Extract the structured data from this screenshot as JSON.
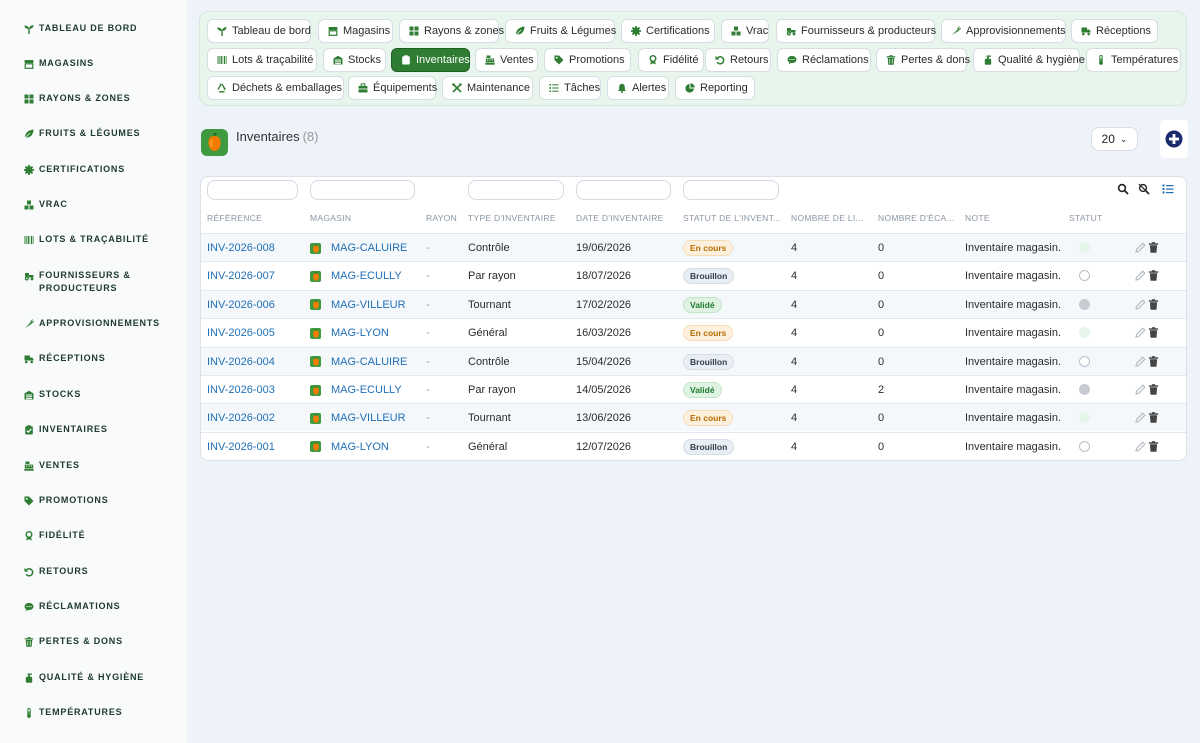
{
  "sidebar": {
    "items": [
      {
        "label": "Tableau de bord",
        "icon": "seedling-icon"
      },
      {
        "label": "Magasins",
        "icon": "store-icon"
      },
      {
        "label": "Rayons & zones",
        "icon": "grid-icon"
      },
      {
        "label": "Fruits & légumes",
        "icon": "leaf-icon"
      },
      {
        "label": "Certifications",
        "icon": "certificate-icon"
      },
      {
        "label": "Vrac",
        "icon": "boxes-icon"
      },
      {
        "label": "Lots & traçabilité",
        "icon": "barcode-icon"
      },
      {
        "label": "Fournisseurs & producteurs",
        "icon": "tractor-icon"
      },
      {
        "label": "Approvisionnements",
        "icon": "carrot-icon"
      },
      {
        "label": "Réceptions",
        "icon": "truck-icon"
      },
      {
        "label": "Stocks",
        "icon": "warehouse-icon"
      },
      {
        "label": "Inventaires",
        "icon": "clipboard-check-icon"
      },
      {
        "label": "Ventes",
        "icon": "cash-register-icon"
      },
      {
        "label": "Promotions",
        "icon": "tag-icon"
      },
      {
        "label": "Fidélité",
        "icon": "award-icon"
      },
      {
        "label": "Retours",
        "icon": "undo-icon"
      },
      {
        "label": "Réclamations",
        "icon": "comment-icon"
      },
      {
        "label": "Pertes & dons",
        "icon": "trash-icon"
      },
      {
        "label": "Qualité & hygiène",
        "icon": "pump-soap-icon"
      },
      {
        "label": "Températures",
        "icon": "thermometer-icon"
      }
    ]
  },
  "topnav": {
    "items": [
      {
        "label": "Tableau de bord",
        "icon": "seedling-icon"
      },
      {
        "label": "Magasins",
        "icon": "store-icon"
      },
      {
        "label": "Rayons & zones",
        "icon": "grid-icon"
      },
      {
        "label": "Fruits & Légumes",
        "icon": "leaf-icon"
      },
      {
        "label": "Certifications",
        "icon": "certificate-icon"
      },
      {
        "label": "Vrac",
        "icon": "boxes-icon"
      },
      {
        "label": "Fournisseurs & producteurs",
        "icon": "tractor-icon"
      },
      {
        "label": "Approvisionnements",
        "icon": "carrot-icon"
      },
      {
        "label": "Réceptions",
        "icon": "truck-icon"
      },
      {
        "label": "Lots & traçabilité",
        "icon": "barcode-icon"
      },
      {
        "label": "Stocks",
        "icon": "warehouse-icon"
      },
      {
        "label": "Inventaires",
        "icon": "clipboard-check-icon",
        "active": true
      },
      {
        "label": "Ventes",
        "icon": "cash-register-icon"
      },
      {
        "label": "Promotions",
        "icon": "tag-icon"
      },
      {
        "label": "Fidélité",
        "icon": "award-icon"
      },
      {
        "label": "Retours",
        "icon": "undo-icon"
      },
      {
        "label": "Réclamations",
        "icon": "comment-icon"
      },
      {
        "label": "Pertes & dons",
        "icon": "trash-icon"
      },
      {
        "label": "Qualité & hygiène",
        "icon": "pump-soap-icon"
      },
      {
        "label": "Températures",
        "icon": "thermometer-icon"
      },
      {
        "label": "Déchets & emballages",
        "icon": "recycle-icon"
      },
      {
        "label": "Équipements",
        "icon": "toolbox-icon"
      },
      {
        "label": "Maintenance",
        "icon": "tools-icon"
      },
      {
        "label": "Tâches",
        "icon": "tasks-icon"
      },
      {
        "label": "Alertes",
        "icon": "bell-icon"
      },
      {
        "label": "Reporting",
        "icon": "chart-pie-icon"
      }
    ]
  },
  "header": {
    "title": "Inventaires",
    "count": "(8)",
    "page_size": "20"
  },
  "table": {
    "columns": [
      "Référence",
      "Magasin",
      "Rayon",
      "Type d'inventaire",
      "Date d'inventaire",
      "Statut de l'invent...",
      "Nombre de li...",
      "Nombre d'éca...",
      "Note",
      "Statut"
    ],
    "rows": [
      {
        "ref": "INV-2026-008",
        "store": "MAG-CALUIRE",
        "rayon": "-",
        "type": "Contrôle",
        "date": "19/06/2026",
        "status": "En cours",
        "status_kind": "encours",
        "lines": "4",
        "gaps": "0",
        "note": "Inventaire magasin.",
        "state": "light"
      },
      {
        "ref": "INV-2026-007",
        "store": "MAG-ECULLY",
        "rayon": "-",
        "type": "Par rayon",
        "date": "18/07/2026",
        "status": "Brouillon",
        "status_kind": "brouillon",
        "lines": "4",
        "gaps": "0",
        "note": "Inventaire magasin.",
        "state": "outline"
      },
      {
        "ref": "INV-2026-006",
        "store": "MAG-VILLEUR",
        "rayon": "-",
        "type": "Tournant",
        "date": "17/02/2026",
        "status": "Validé",
        "status_kind": "valide",
        "lines": "4",
        "gaps": "0",
        "note": "Inventaire magasin.",
        "state": "grey"
      },
      {
        "ref": "INV-2026-005",
        "store": "MAG-LYON",
        "rayon": "-",
        "type": "Général",
        "date": "16/03/2026",
        "status": "En cours",
        "status_kind": "encours",
        "lines": "4",
        "gaps": "0",
        "note": "Inventaire magasin.",
        "state": "light"
      },
      {
        "ref": "INV-2026-004",
        "store": "MAG-CALUIRE",
        "rayon": "-",
        "type": "Contrôle",
        "date": "15/04/2026",
        "status": "Brouillon",
        "status_kind": "brouillon",
        "lines": "4",
        "gaps": "0",
        "note": "Inventaire magasin.",
        "state": "outline"
      },
      {
        "ref": "INV-2026-003",
        "store": "MAG-ECULLY",
        "rayon": "-",
        "type": "Par rayon",
        "date": "14/05/2026",
        "status": "Validé",
        "status_kind": "valide",
        "lines": "4",
        "gaps": "2",
        "note": "Inventaire magasin.",
        "state": "grey"
      },
      {
        "ref": "INV-2026-002",
        "store": "MAG-VILLEUR",
        "rayon": "-",
        "type": "Tournant",
        "date": "13/06/2026",
        "status": "En cours",
        "status_kind": "encours",
        "lines": "4",
        "gaps": "0",
        "note": "Inventaire magasin.",
        "state": "light"
      },
      {
        "ref": "INV-2026-001",
        "store": "MAG-LYON",
        "rayon": "-",
        "type": "Général",
        "date": "12/07/2026",
        "status": "Brouillon",
        "status_kind": "brouillon",
        "lines": "4",
        "gaps": "0",
        "note": "Inventaire magasin.",
        "state": "outline"
      }
    ]
  },
  "colors": {
    "accent": "#2e7d32",
    "link": "#1f6fb8",
    "add_button": "#1a2a6c"
  }
}
